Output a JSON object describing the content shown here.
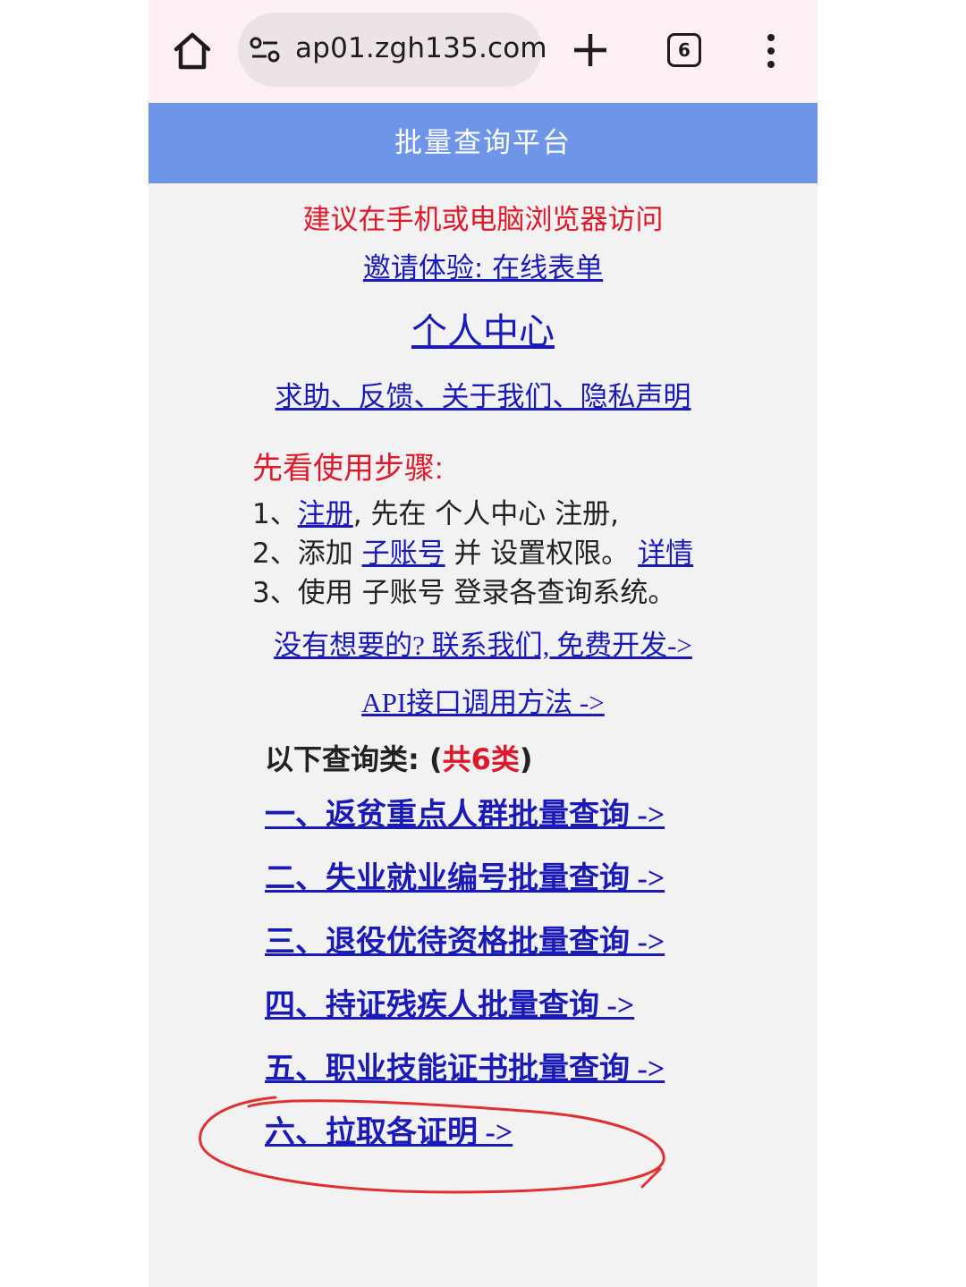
{
  "browser": {
    "url": "ap01.zgh135.com",
    "tab_count": "6"
  },
  "header": {
    "title": "批量查询平台"
  },
  "links": {
    "notice": "建议在手机或电脑浏览器访问",
    "invite": "邀请体验: 在线表单",
    "personal_center": "个人中心",
    "help": "求助、反馈、关于我们、隐私声明",
    "contact": "没有想要的? 联系我们, 免费开发->",
    "api": "API接口调用方法 ->"
  },
  "steps": {
    "title": "先看使用步骤:",
    "step1_prefix": "1、",
    "step1_link": "注册",
    "step1_rest": ", 先在 个人中心 注册,",
    "step2_prefix": "2、添加 ",
    "step2_link": "子账号",
    "step2_rest": " 并 设置权限。 ",
    "step2_detail": "详情",
    "step3": "3、使用 子账号 登录各查询系统。"
  },
  "categories": {
    "label": "以下查询类: (",
    "count": "共6类",
    "close": ")",
    "items": [
      "一、返贫重点人群批量查询 ->",
      "二、失业就业编号批量查询 ->",
      "三、退役优待资格批量查询 ->",
      "四、持证残疾人批量查询 ->",
      "五、职业技能证书批量查询 ->",
      "六、拉取各证明 ->"
    ]
  },
  "colors": {
    "header_bg": "#6f95e8",
    "link": "#1a1ab8",
    "accent_red": "#e0192a",
    "annotation": "#e03030"
  }
}
